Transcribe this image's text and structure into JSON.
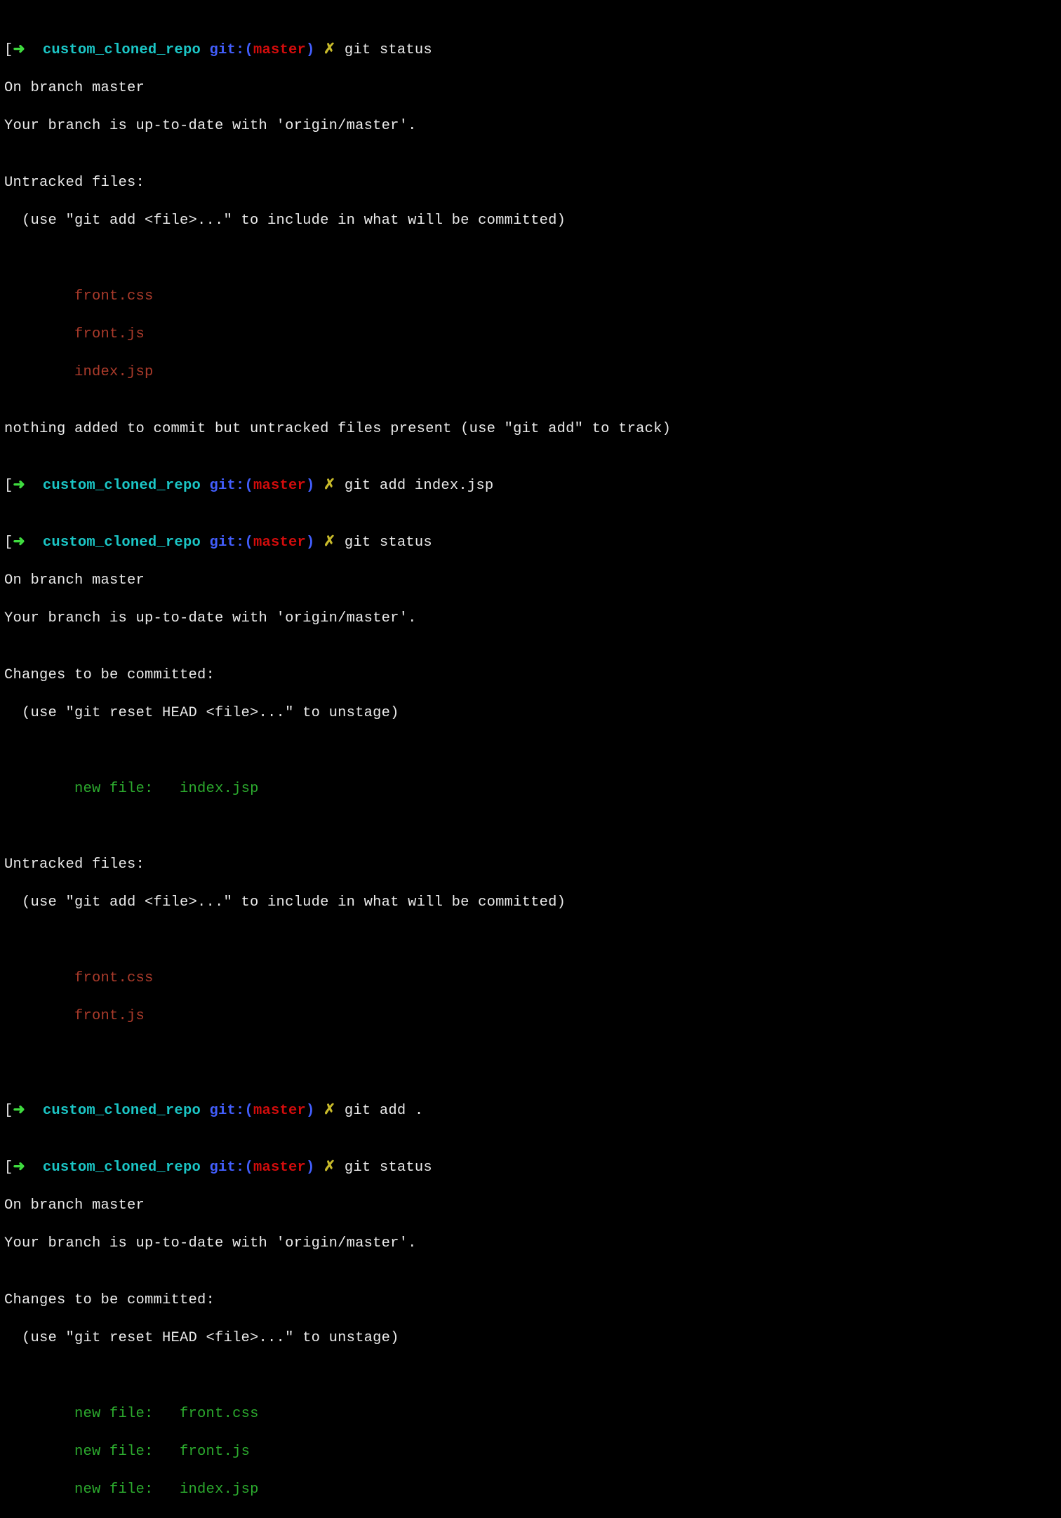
{
  "prompt": {
    "arrow": "➜  ",
    "dir": "custom_cloned_repo",
    "git_label": " git:(",
    "branch": "master",
    "git_close": ")",
    "dirty": " ✗ "
  },
  "colors": {
    "arrow": "#3fdc3f",
    "dir": "#1bc6c6",
    "git_label": "#425efd",
    "branch": "#d30c0c",
    "dirty": "#c8ba2a",
    "untracked": "#ab3b2b",
    "staged": "#2cab2e",
    "text": "#eaeaea"
  },
  "blocks": [
    {
      "command": "git status",
      "out_head": [
        "On branch master",
        "Your branch is up-to-date with 'origin/master'.",
        ""
      ],
      "untracked": {
        "header": "Untracked files:",
        "hint": "  (use \"git add <file>...\" to include in what will be committed)",
        "files": [
          "front.css",
          "front.js",
          "index.jsp"
        ]
      },
      "footer": [
        "",
        "nothing added to commit but untracked files present (use \"git add\" to track)"
      ]
    },
    {
      "command": "git add index.jsp"
    },
    {
      "command": "git status",
      "out_head": [
        "On branch master",
        "Your branch is up-to-date with 'origin/master'.",
        ""
      ],
      "staged": {
        "header": "Changes to be committed:",
        "hint": "  (use \"git reset HEAD <file>...\" to unstage)",
        "files": [
          "new file:   index.jsp"
        ]
      },
      "untracked": {
        "header": "Untracked files:",
        "hint": "  (use \"git add <file>...\" to include in what will be committed)",
        "files": [
          "front.css",
          "front.js"
        ]
      }
    },
    {
      "command": "git add ."
    },
    {
      "command": "git status",
      "out_head": [
        "On branch master",
        "Your branch is up-to-date with 'origin/master'.",
        ""
      ],
      "staged": {
        "header": "Changes to be committed:",
        "hint": "  (use \"git reset HEAD <file>...\" to unstage)",
        "files": [
          "new file:   front.css",
          "new file:   front.js",
          "new file:   index.jsp"
        ]
      }
    }
  ],
  "indent_files": "        "
}
